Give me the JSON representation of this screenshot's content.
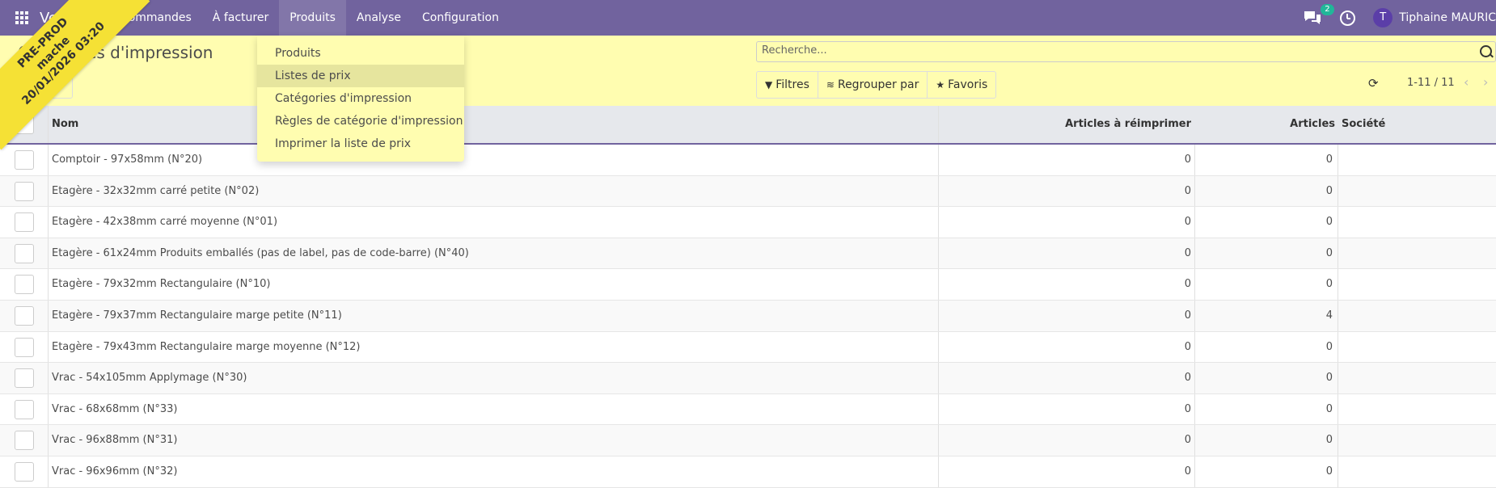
{
  "navbar": {
    "brand": "Ventes",
    "items": [
      "Commandes",
      "À facturer",
      "Produits",
      "Analyse",
      "Configuration"
    ],
    "active": "Produits",
    "chat_badge": "2",
    "user_initial": "T",
    "user_name": "Tiphaine MAURIC"
  },
  "ribbon": {
    "line1": "PRE-PROD",
    "line2": "mache",
    "line3": "20/01/2026 03:20"
  },
  "page": {
    "title": "Catégories d'impression"
  },
  "search": {
    "placeholder": "Recherche..."
  },
  "filters": {
    "filters_label": "Filtres",
    "group_label": "Regrouper par",
    "favorites_label": "Favoris"
  },
  "pager": {
    "label": "1-11 / 11"
  },
  "dropdown": {
    "items": [
      "Produits",
      "Listes de prix",
      "Catégories d'impression",
      "Règles de catégorie d'impression",
      "Imprimer la liste de prix"
    ],
    "hovered": "Listes de prix"
  },
  "table": {
    "headers": {
      "name": "Nom",
      "reprint": "Articles à réimprimer",
      "articles": "Articles",
      "company": "Société"
    },
    "rows": [
      {
        "name": "Comptoir - 97x58mm (N°20)",
        "reprint": "0",
        "articles": "0"
      },
      {
        "name": "Etagère - 32x32mm carré petite (N°02)",
        "reprint": "0",
        "articles": "0"
      },
      {
        "name": "Etagère - 42x38mm carré moyenne (N°01)",
        "reprint": "0",
        "articles": "0"
      },
      {
        "name": "Etagère - 61x24mm Produits emballés (pas de label, pas de code-barre) (N°40)",
        "reprint": "0",
        "articles": "0"
      },
      {
        "name": "Etagère - 79x32mm Rectangulaire (N°10)",
        "reprint": "0",
        "articles": "0"
      },
      {
        "name": "Etagère - 79x37mm Rectangulaire marge petite (N°11)",
        "reprint": "0",
        "articles": "4"
      },
      {
        "name": "Etagère - 79x43mm Rectangulaire marge moyenne (N°12)",
        "reprint": "0",
        "articles": "0"
      },
      {
        "name": "Vrac - 54x105mm Applymage (N°30)",
        "reprint": "0",
        "articles": "0"
      },
      {
        "name": "Vrac - 68x68mm (N°33)",
        "reprint": "0",
        "articles": "0"
      },
      {
        "name": "Vrac - 96x88mm (N°31)",
        "reprint": "0",
        "articles": "0"
      },
      {
        "name": "Vrac - 96x96mm (N°32)",
        "reprint": "0",
        "articles": "0"
      }
    ]
  }
}
